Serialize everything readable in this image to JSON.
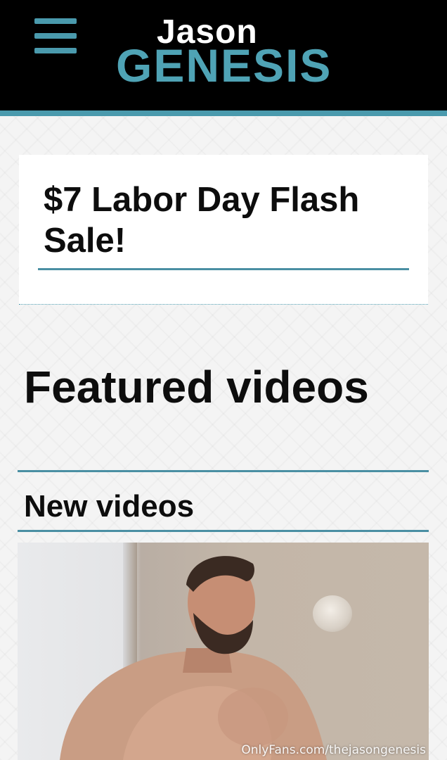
{
  "header": {
    "logo_top": "Jason",
    "logo_bottom": "GENESIS"
  },
  "colors": {
    "accent": "#4a9aad",
    "header_bg": "#000000",
    "text": "#0d0d0d"
  },
  "icons": {
    "menu": "hamburger-menu-icon"
  },
  "promo": {
    "title": "$7 Labor Day Flash Sale!"
  },
  "sections": {
    "featured_title": "Featured videos",
    "new_title": "New videos"
  },
  "video": {
    "watermark": "OnlyFans.com/thejasongenesis"
  }
}
